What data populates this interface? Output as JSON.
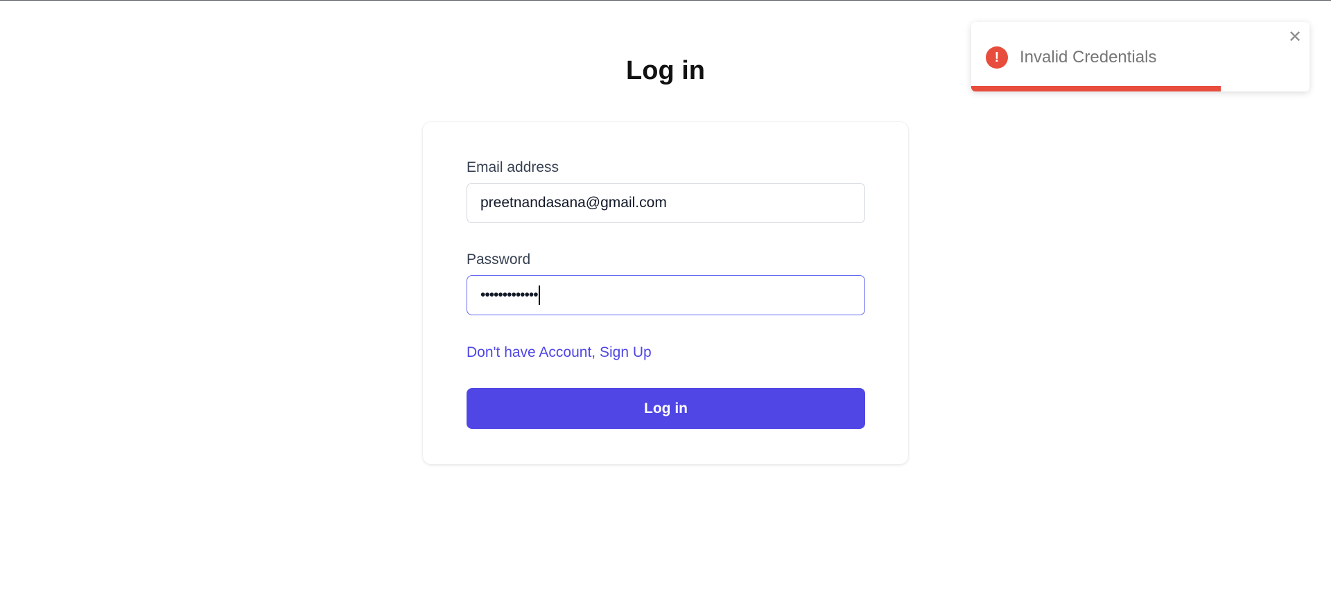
{
  "page": {
    "title": "Log in"
  },
  "form": {
    "email_label": "Email address",
    "email_value": "preetnandasana@gmail.com",
    "password_label": "Password",
    "password_mask": "•••••••••••••",
    "signup_link": "Don't have Account, Sign Up",
    "submit_label": "Log in"
  },
  "toast": {
    "icon": "error-icon",
    "icon_glyph": "!",
    "message": "Invalid Credentials",
    "close_glyph": "✕",
    "progress_remaining": 0.737,
    "color": "#e74c3c"
  },
  "colors": {
    "accent": "#4f46e5",
    "error": "#e74c3c"
  }
}
